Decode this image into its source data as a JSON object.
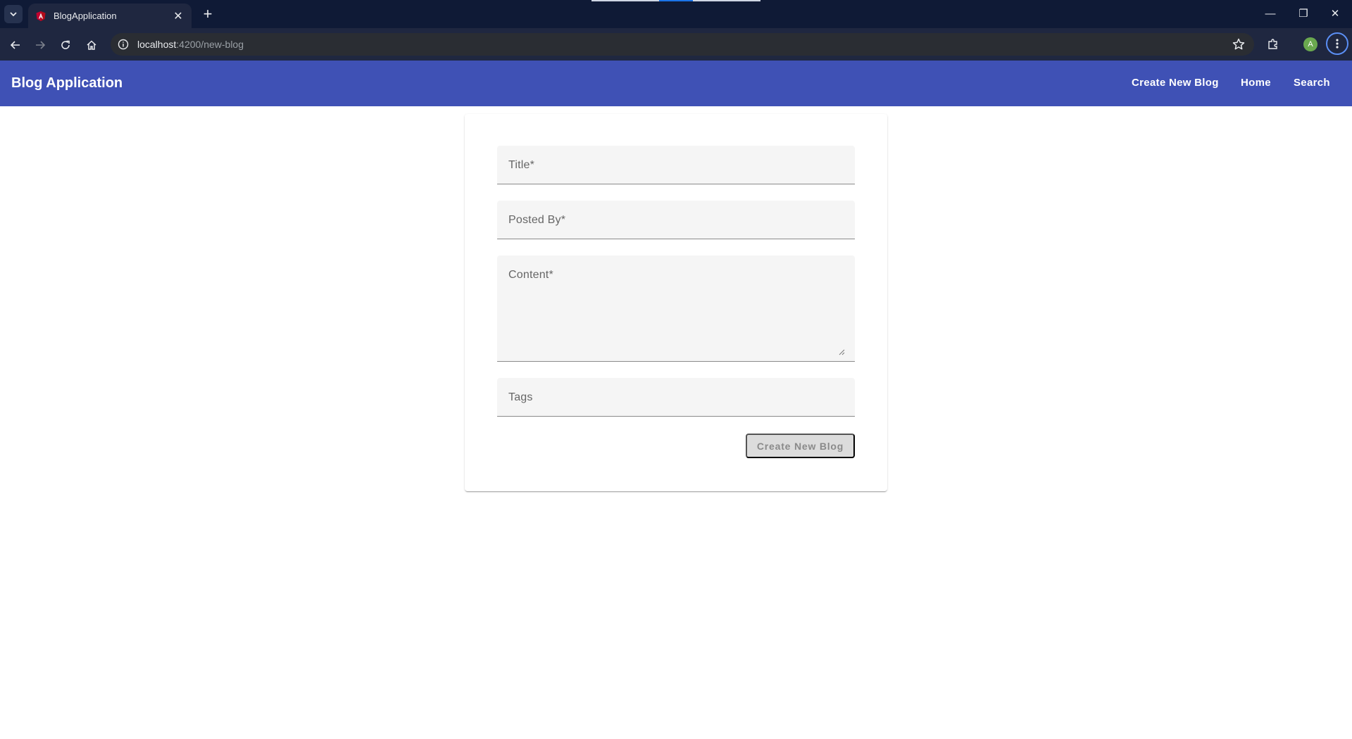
{
  "browser": {
    "tab_title": "BlogApplication",
    "url_host": "localhost",
    "url_path": ":4200/new-blog",
    "profile_initial": "A",
    "icons": {
      "tab_search": "chevron-down-icon",
      "tab_favicon": "angular-logo-icon",
      "tab_close": "close-icon",
      "new_tab": "plus-icon",
      "back": "arrow-left-icon",
      "forward": "arrow-right-icon",
      "reload": "reload-icon",
      "home": "home-icon",
      "site_info": "info-icon",
      "bookmark": "star-icon",
      "extensions": "puzzle-icon",
      "menu": "kebab-menu-icon",
      "minimize": "minimize-icon",
      "restore": "restore-icon",
      "close_window": "close-icon"
    },
    "glyphs": {
      "tab_close": "✕",
      "new_tab": "+",
      "minimize": "—",
      "restore": "❐",
      "close_window": "✕"
    }
  },
  "app": {
    "title": "Blog Application",
    "nav": {
      "create": "Create New Blog",
      "home": "Home",
      "search": "Search"
    },
    "colors": {
      "primary": "#3f51b5",
      "field_bg": "#f5f5f5"
    }
  },
  "form": {
    "title_label": "Title*",
    "posted_by_label": "Posted By*",
    "content_label": "Content*",
    "tags_label": "Tags",
    "submit_label": "Create New Blog"
  }
}
